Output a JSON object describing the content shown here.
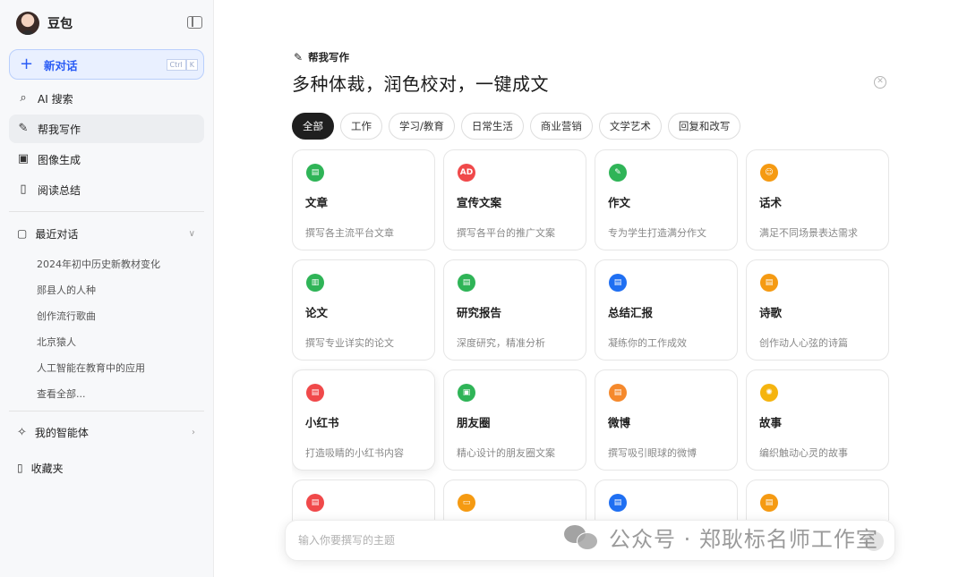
{
  "sidebar": {
    "brand_name": "豆包",
    "new_chat": {
      "label": "新对话",
      "kbd": [
        "Ctrl",
        "K"
      ]
    },
    "nav": [
      {
        "label": "AI 搜索",
        "icon": "search-icon"
      },
      {
        "label": "帮我写作",
        "icon": "pen-icon",
        "active": true
      },
      {
        "label": "图像生成",
        "icon": "image-icon"
      },
      {
        "label": "阅读总结",
        "icon": "book-icon"
      }
    ],
    "recent": {
      "label": "最近对话",
      "items": [
        "2024年初中历史新教材变化",
        "郧县人的人种",
        "创作流行歌曲",
        "北京猿人",
        "人工智能在教育中的应用",
        "查看全部..."
      ]
    },
    "agents_label": "我的智能体",
    "favorites_label": "收藏夹"
  },
  "main": {
    "write_tag": "帮我写作",
    "headline": "多种体裁，润色校对，一键成文",
    "tabs": [
      "全部",
      "工作",
      "学习/教育",
      "日常生活",
      "商业营销",
      "文学艺术",
      "回复和改写"
    ],
    "cards": [
      {
        "title": "文章",
        "desc": "撰写各主流平台文章",
        "color": "#2fb457",
        "glyph": "▤"
      },
      {
        "title": "宣传文案",
        "desc": "撰写各平台的推广文案",
        "color": "#f0494a",
        "glyph": "AD"
      },
      {
        "title": "作文",
        "desc": "专为学生打造满分作文",
        "color": "#2fb457",
        "glyph": "✎"
      },
      {
        "title": "话术",
        "desc": "满足不同场景表达需求",
        "color": "#f59a12",
        "glyph": "☺"
      },
      {
        "title": "论文",
        "desc": "撰写专业详实的论文",
        "color": "#2fb457",
        "glyph": "▥"
      },
      {
        "title": "研究报告",
        "desc": "深度研究，精准分析",
        "color": "#2fb457",
        "glyph": "▤"
      },
      {
        "title": "总结汇报",
        "desc": "凝练你的工作成效",
        "color": "#1f6ff2",
        "glyph": "▤"
      },
      {
        "title": "诗歌",
        "desc": "创作动人心弦的诗篇",
        "color": "#f59a12",
        "glyph": "▤"
      },
      {
        "title": "小红书",
        "desc": "打造吸睛的小红书内容",
        "color": "#f0494a",
        "glyph": "▤"
      },
      {
        "title": "朋友圈",
        "desc": "精心设计的朋友圈文案",
        "color": "#2fb457",
        "glyph": "▣"
      },
      {
        "title": "微博",
        "desc": "撰写吸引眼球的微博",
        "color": "#f5892c",
        "glyph": "▤"
      },
      {
        "title": "故事",
        "desc": "编织触动心灵的故事",
        "color": "#f5b40f",
        "glyph": "✺"
      },
      {
        "title": "",
        "desc": "",
        "color": "#f0494a",
        "glyph": "▤"
      },
      {
        "title": "",
        "desc": "",
        "color": "#f59a12",
        "glyph": "▭"
      },
      {
        "title": "",
        "desc": "",
        "color": "#1f6ff2",
        "glyph": "▤"
      },
      {
        "title": "",
        "desc": "",
        "color": "#f59a12",
        "glyph": "▤"
      }
    ],
    "input_placeholder": "输入你要撰写的主题"
  },
  "watermark": "公众号 · 郑耿标名师工作室"
}
